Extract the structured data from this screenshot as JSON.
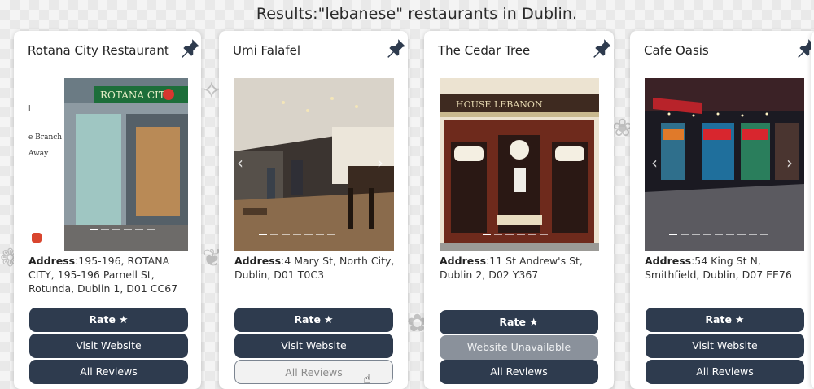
{
  "heading": "Results:\"lebanese\" restaurants in Dublin.",
  "pin_icon": "pin-icon",
  "star_glyph": "★",
  "address_label": "Address",
  "colors": {
    "button": "#2e3b4e",
    "button_disabled": "#8a919b",
    "card": "#ffffff"
  },
  "cards": [
    {
      "name": "Rotana City Restaurant",
      "address": ":195-196, ROTANA CITY, 195-196 Parnell St, Rotunda, Dublin 1, D01 CC67",
      "photo_sign": "ROTANA CITY",
      "rate_label": "Rate",
      "website_label": "Visit Website",
      "reviews_label": "All Reviews"
    },
    {
      "name": "Umi Falafel",
      "address": ":4 Mary St, North City, Dublin, D01 T0C3",
      "rate_label": "Rate",
      "website_label": "Visit Website",
      "reviews_label": "All Reviews"
    },
    {
      "name": "The Cedar Tree",
      "address": ":11 St Andrew's St, Dublin 2, D02 Y367",
      "photo_sign": "HOUSE LEBANON",
      "rate_label": "Rate",
      "website_label": "Website Unavailable",
      "reviews_label": "All Reviews"
    },
    {
      "name": "Cafe Oasis",
      "address": ":54 King St N, Smithfield, Dublin, D07 EE76",
      "rate_label": "Rate",
      "website_label": "Visit Website",
      "reviews_label": "All Reviews"
    }
  ]
}
